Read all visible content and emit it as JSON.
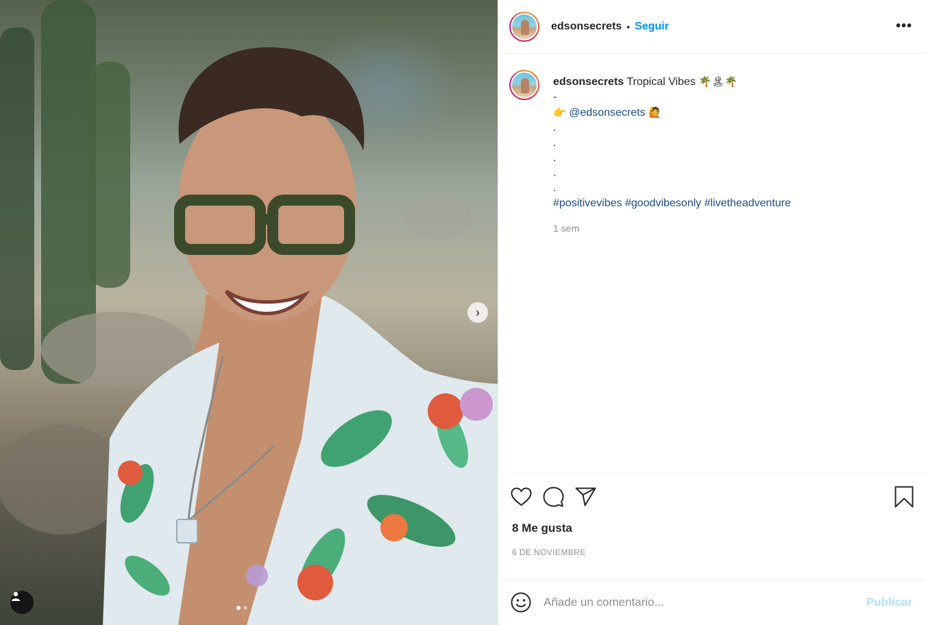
{
  "media": {
    "next_icon": "chevron-right-icon",
    "tag_icon": "user-tag-icon",
    "carousel": {
      "count": 2,
      "active": 0
    }
  },
  "header": {
    "username": "edsonsecrets",
    "separator": "•",
    "follow_label": "Seguir",
    "more_label": "•••"
  },
  "caption": {
    "username": "edsonsecrets",
    "title": "Tropical Vibes",
    "title_emoji": "🌴🏝🌴",
    "dash": "-",
    "pointer_emoji": "👉",
    "mention": "@edsonsecrets",
    "wave_emoji": "🙋",
    "dots": [
      ".",
      ".",
      ".",
      ".",
      "."
    ],
    "hashtags": "#positivevibes #goodvibesonly #livetheadventure",
    "time": "1 sem"
  },
  "actions": {
    "like_icon": "heart-icon",
    "comment_icon": "comment-icon",
    "share_icon": "paper-plane-icon",
    "save_icon": "bookmark-icon"
  },
  "likes_text": "8 Me gusta",
  "date_text": "6 DE NOVIEMBRE",
  "comment_box": {
    "emoji_icon": "smiley-icon",
    "placeholder": "Añade un comentario...",
    "post_label": "Publicar"
  },
  "colors": {
    "link_blue": "#0095f6",
    "mention_blue": "#1a4c87",
    "post_disabled": "#b2dffc",
    "muted": "#8e8e8e"
  }
}
